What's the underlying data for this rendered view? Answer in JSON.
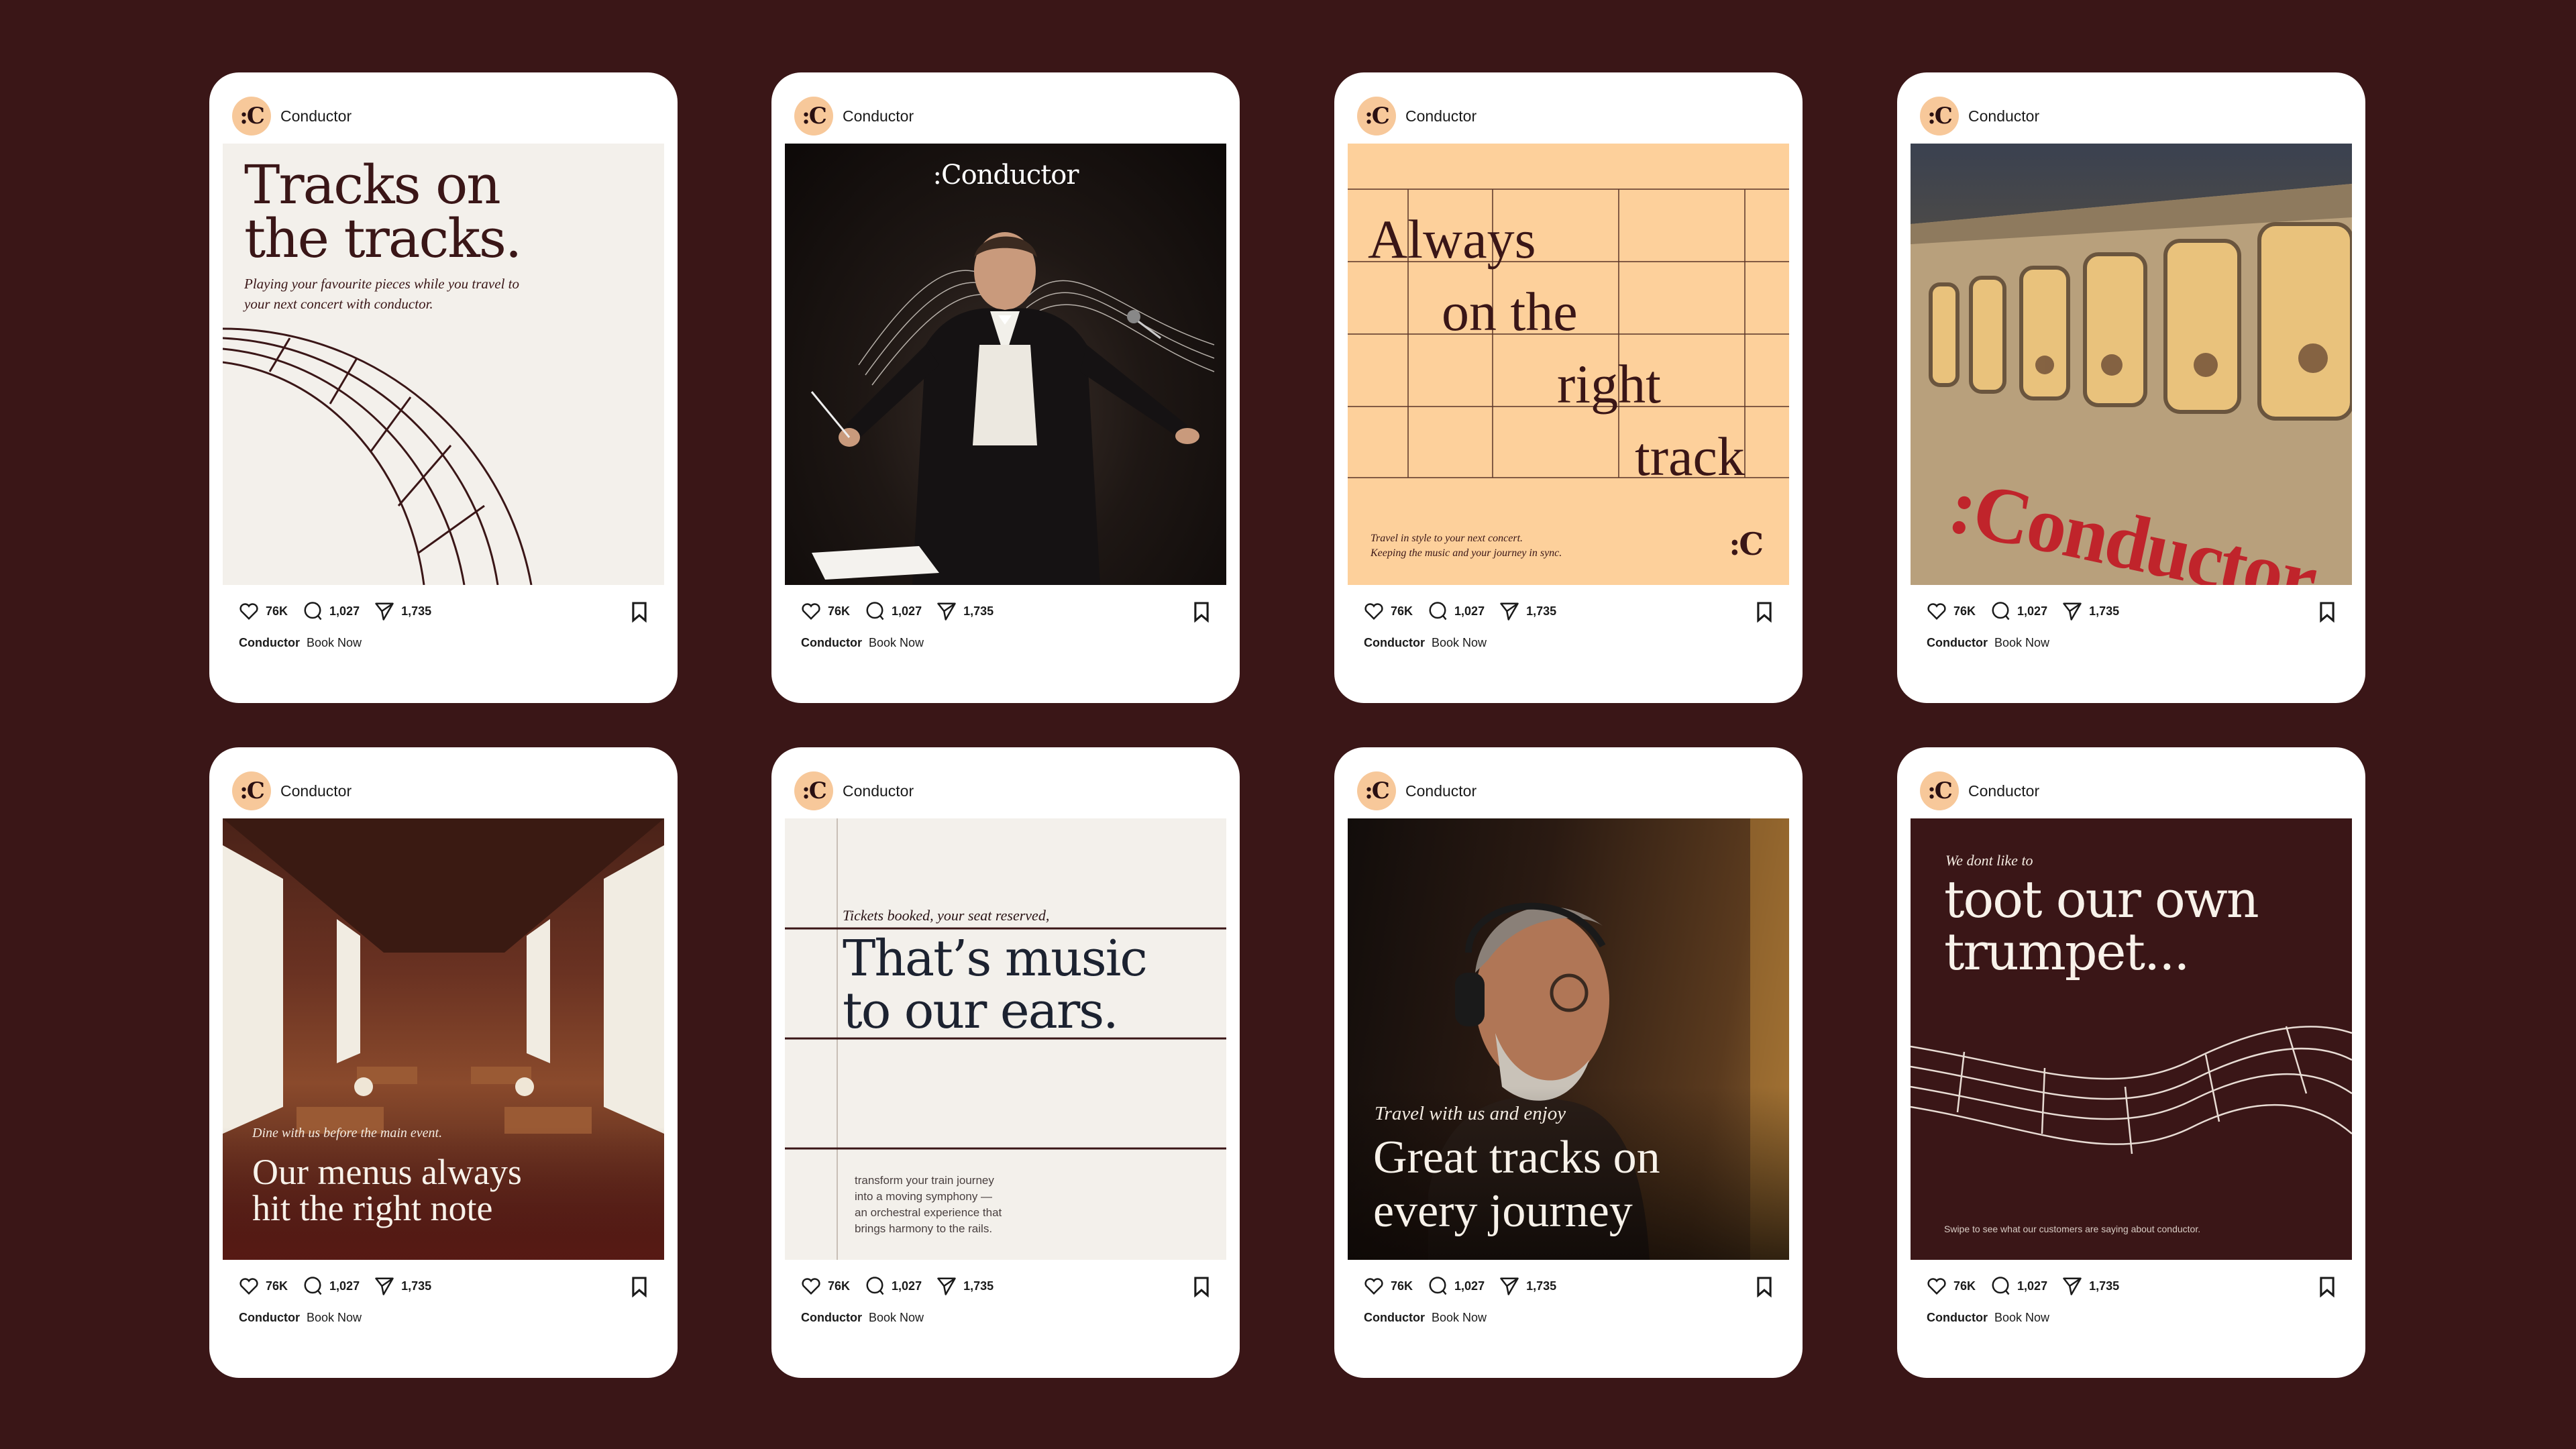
{
  "brand": {
    "username": "Conductor",
    "avatar_glyph": ":C",
    "logo_text": ":Conductor",
    "colors": {
      "background": "#3a1617",
      "card": "#ffffff",
      "cream": "#f3f0eb",
      "peach": "#fdd09b",
      "maroon": "#3a1617",
      "ink": "#2a1416"
    }
  },
  "post_actions": {
    "likes": "76K",
    "comments": "1,027",
    "shares": "1,735",
    "caption_user": "Conductor",
    "caption_text": "Book Now"
  },
  "posts": [
    {
      "headline": "Tracks on the tracks.",
      "sub": "Playing your favourite pieces while you travel to your next concert with conductor."
    },
    {
      "logo": ":Conductor"
    },
    {
      "words": [
        "Always",
        "on the",
        "right",
        "track"
      ],
      "note_line1": "Travel in style to your next concert.",
      "note_line2": "Keeping the music and your journey in sync.",
      "mark": ":C"
    },
    {
      "train_sign": ":Conductor"
    },
    {
      "sub": "Dine with us before the main event.",
      "headline_line1": "Our menus always",
      "headline_line2": "hit the right note"
    },
    {
      "sub": "Tickets booked, your seat reserved,",
      "headline_line1": "That’s music",
      "headline_line2": "to our ears.",
      "body_line1": "transform your train journey",
      "body_line2": "into a moving symphony —",
      "body_line3": "an orchestral experience that",
      "body_line4": "brings harmony to the rails."
    },
    {
      "sub": "Travel with us and enjoy",
      "headline_line1": "Great tracks on",
      "headline_line2": "every journey"
    },
    {
      "sub": "We dont like to",
      "headline_line1": "toot our own",
      "headline_line2": "trumpet...",
      "footer": "Swipe to see what our customers are saying about conductor."
    }
  ]
}
